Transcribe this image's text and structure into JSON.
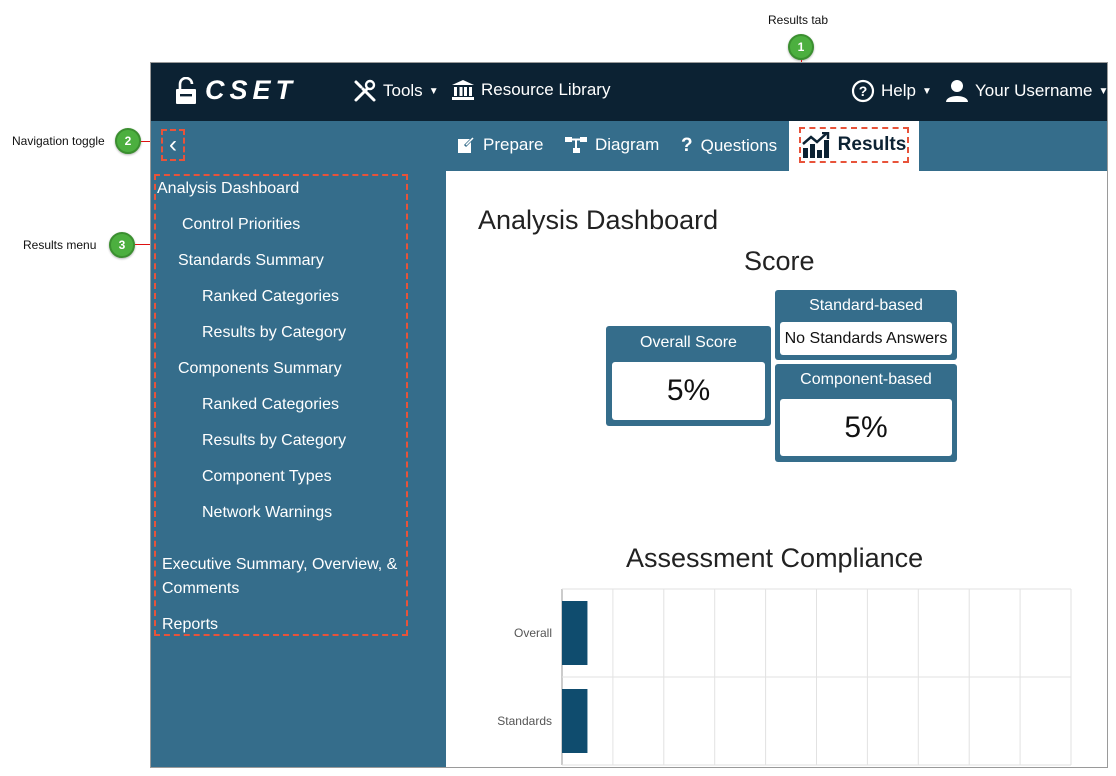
{
  "callouts": {
    "results_tab": {
      "label": "Results tab",
      "number": "1"
    },
    "nav_toggle": {
      "label": "Navigation toggle",
      "number": "2"
    },
    "results_menu": {
      "label": "Results menu",
      "number": "3"
    }
  },
  "topbar": {
    "logo": "CSET",
    "tools": "Tools",
    "resource_library": "Resource Library",
    "help": "Help",
    "username": "Your Username"
  },
  "tabs": {
    "prepare": "Prepare",
    "diagram": "Diagram",
    "questions": "Questions",
    "results": "Results"
  },
  "sidebar": {
    "items": [
      "Analysis Dashboard",
      "Control Priorities",
      "Standards Summary",
      "Ranked Categories",
      "Results by Category",
      "Components Summary",
      "Ranked Categories",
      "Results by Category",
      "Component Types",
      "Network Warnings",
      "Executive Summary, Overview, &",
      "Comments",
      "Reports"
    ]
  },
  "main": {
    "title": "Analysis Dashboard",
    "score_title": "Score",
    "overall": {
      "label": "Overall Score",
      "value": "5%"
    },
    "standard": {
      "label": "Standard-based",
      "value": "No Standards Answers"
    },
    "component": {
      "label": "Component-based",
      "value": "5%"
    },
    "compliance_title": "Assessment Compliance"
  },
  "chart_data": {
    "type": "bar",
    "orientation": "horizontal",
    "categories": [
      "Overall",
      "Standards"
    ],
    "values": [
      5,
      5
    ],
    "xlim": [
      0,
      100
    ],
    "grid": true,
    "color": "#0f4c6e"
  },
  "colors": {
    "topbar": "#0c2233",
    "accent": "#356d8b",
    "callout": "#4caf3f",
    "highlight": "#e8533a"
  }
}
